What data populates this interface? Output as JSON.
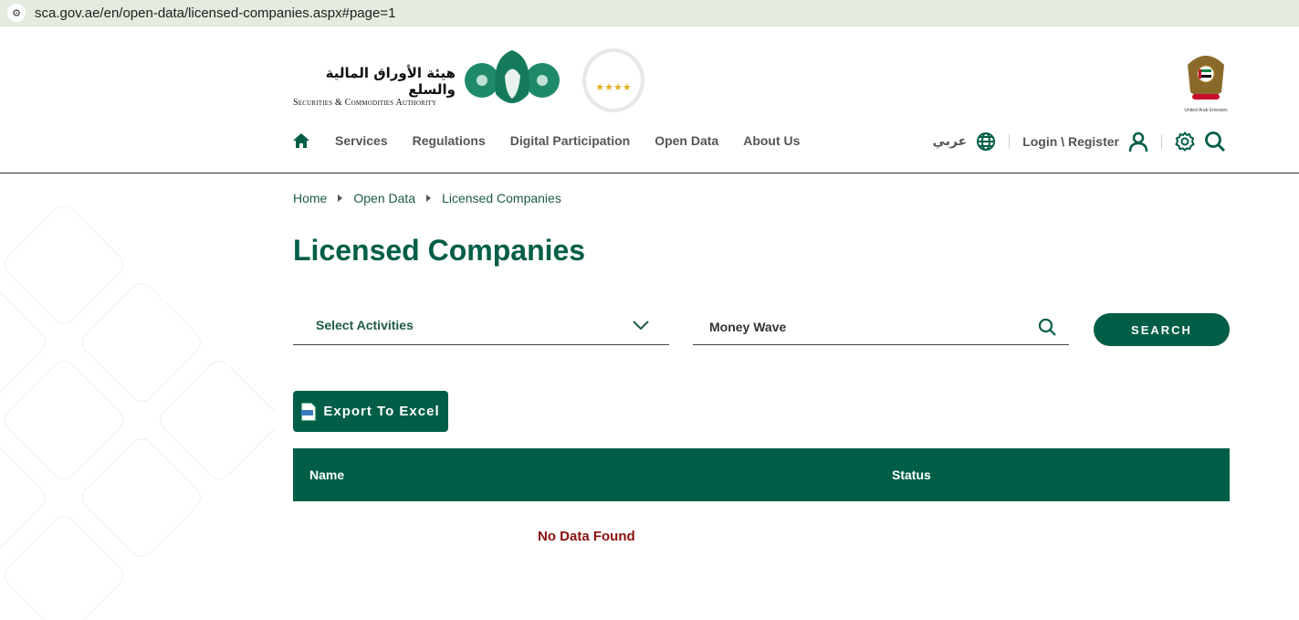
{
  "browser": {
    "url": "sca.gov.ae/en/open-data/licensed-companies.aspx#page=1"
  },
  "header": {
    "logo_ar": "هيئة الأوراق المالية والسلع",
    "logo_en": "Securities & Commodities Authority",
    "uae_label": "United Arab Emirates",
    "nav": [
      "Services",
      "Regulations",
      "Digital Participation",
      "Open Data",
      "About Us"
    ],
    "lang": "عربي",
    "login": "Login \\ Register"
  },
  "breadcrumb": [
    "Home",
    "Open Data",
    "Licensed Companies"
  ],
  "page_title": "Licensed Companies",
  "filters": {
    "activities_placeholder": "Select Activities",
    "search_value": "Money Wave",
    "search_button": "SEARCH"
  },
  "export_label": "Export To Excel",
  "table": {
    "columns": [
      "Name",
      "Status"
    ],
    "empty": "No Data Found"
  },
  "colors": {
    "primary": "#005e47",
    "error": "#8b1010"
  }
}
